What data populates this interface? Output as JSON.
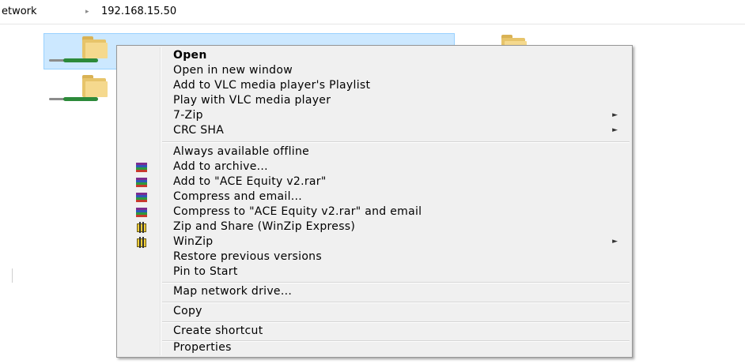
{
  "address_bar": {
    "segments": [
      "etwork",
      "192.168.15.50"
    ],
    "separator": "▸"
  },
  "context_menu": {
    "group1": [
      {
        "label": "Open",
        "bold": true,
        "submenu": false
      },
      {
        "label": "Open in new window",
        "submenu": false
      },
      {
        "label": "Add to VLC media player's Playlist",
        "submenu": false
      },
      {
        "label": "Play with VLC media player",
        "submenu": false
      },
      {
        "label": "7-Zip",
        "submenu": true
      },
      {
        "label": "CRC SHA",
        "submenu": true
      }
    ],
    "group2": [
      {
        "label": "Always available offline",
        "icon": ""
      },
      {
        "label": "Add to archive...",
        "icon": "winrar-icon"
      },
      {
        "label": "Add to \"ACE Equity v2.rar\"",
        "icon": "winrar-icon"
      },
      {
        "label": "Compress and email...",
        "icon": "winrar-icon"
      },
      {
        "label": "Compress to \"ACE Equity v2.rar\" and email",
        "icon": "winrar-icon"
      },
      {
        "label": "Zip and Share (WinZip Express)",
        "icon": "winzip-icon"
      },
      {
        "label": "WinZip",
        "icon": "winzip-icon",
        "submenu": true
      },
      {
        "label": "Restore previous versions",
        "icon": ""
      },
      {
        "label": "Pin to Start",
        "icon": ""
      }
    ],
    "group3": [
      {
        "label": "Map network drive..."
      }
    ],
    "group4": [
      {
        "label": "Copy"
      }
    ],
    "group5": [
      {
        "label": "Create shortcut"
      }
    ],
    "group6": [
      {
        "label": "Properties"
      }
    ],
    "submenu_arrow": "►"
  },
  "colors": {
    "selection_fill": "#cce8ff",
    "selection_border": "#99d1ff",
    "menu_background": "#f0f0f0",
    "folder": "#e7c46a",
    "network_cable": "#2c8a3a"
  }
}
